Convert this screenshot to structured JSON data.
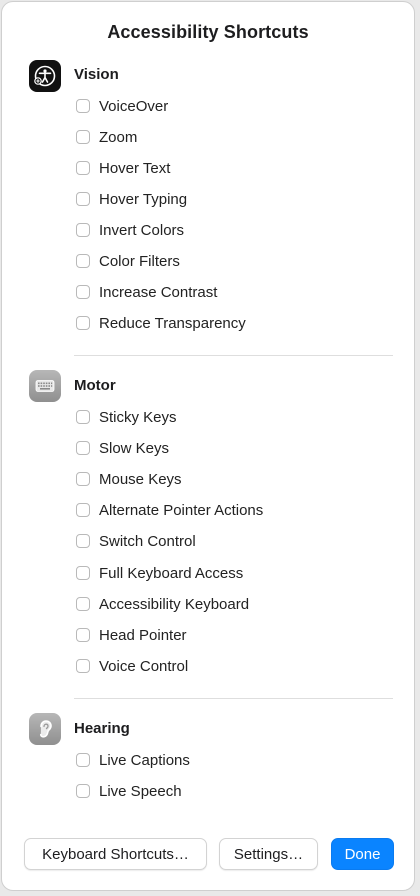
{
  "window": {
    "title": "Accessibility Shortcuts"
  },
  "sections": [
    {
      "title": "Vision",
      "icon": "accessibility-person-icon",
      "items": [
        "VoiceOver",
        "Zoom",
        "Hover Text",
        "Hover Typing",
        "Invert Colors",
        "Color Filters",
        "Increase Contrast",
        "Reduce Transparency"
      ]
    },
    {
      "title": "Motor",
      "icon": "keyboard-icon",
      "items": [
        "Sticky Keys",
        "Slow Keys",
        "Mouse Keys",
        "Alternate Pointer Actions",
        "Switch Control",
        "Full Keyboard Access",
        "Accessibility Keyboard",
        "Head Pointer",
        "Voice Control"
      ]
    },
    {
      "title": "Hearing",
      "icon": "ear-icon",
      "items": [
        "Live Captions",
        "Live Speech"
      ]
    }
  ],
  "buttons": {
    "keyboard_shortcuts": "Keyboard Shortcuts…",
    "settings": "Settings…",
    "done": "Done"
  },
  "colors": {
    "primary_button": "#0a84ff",
    "background": "#ffffff"
  }
}
